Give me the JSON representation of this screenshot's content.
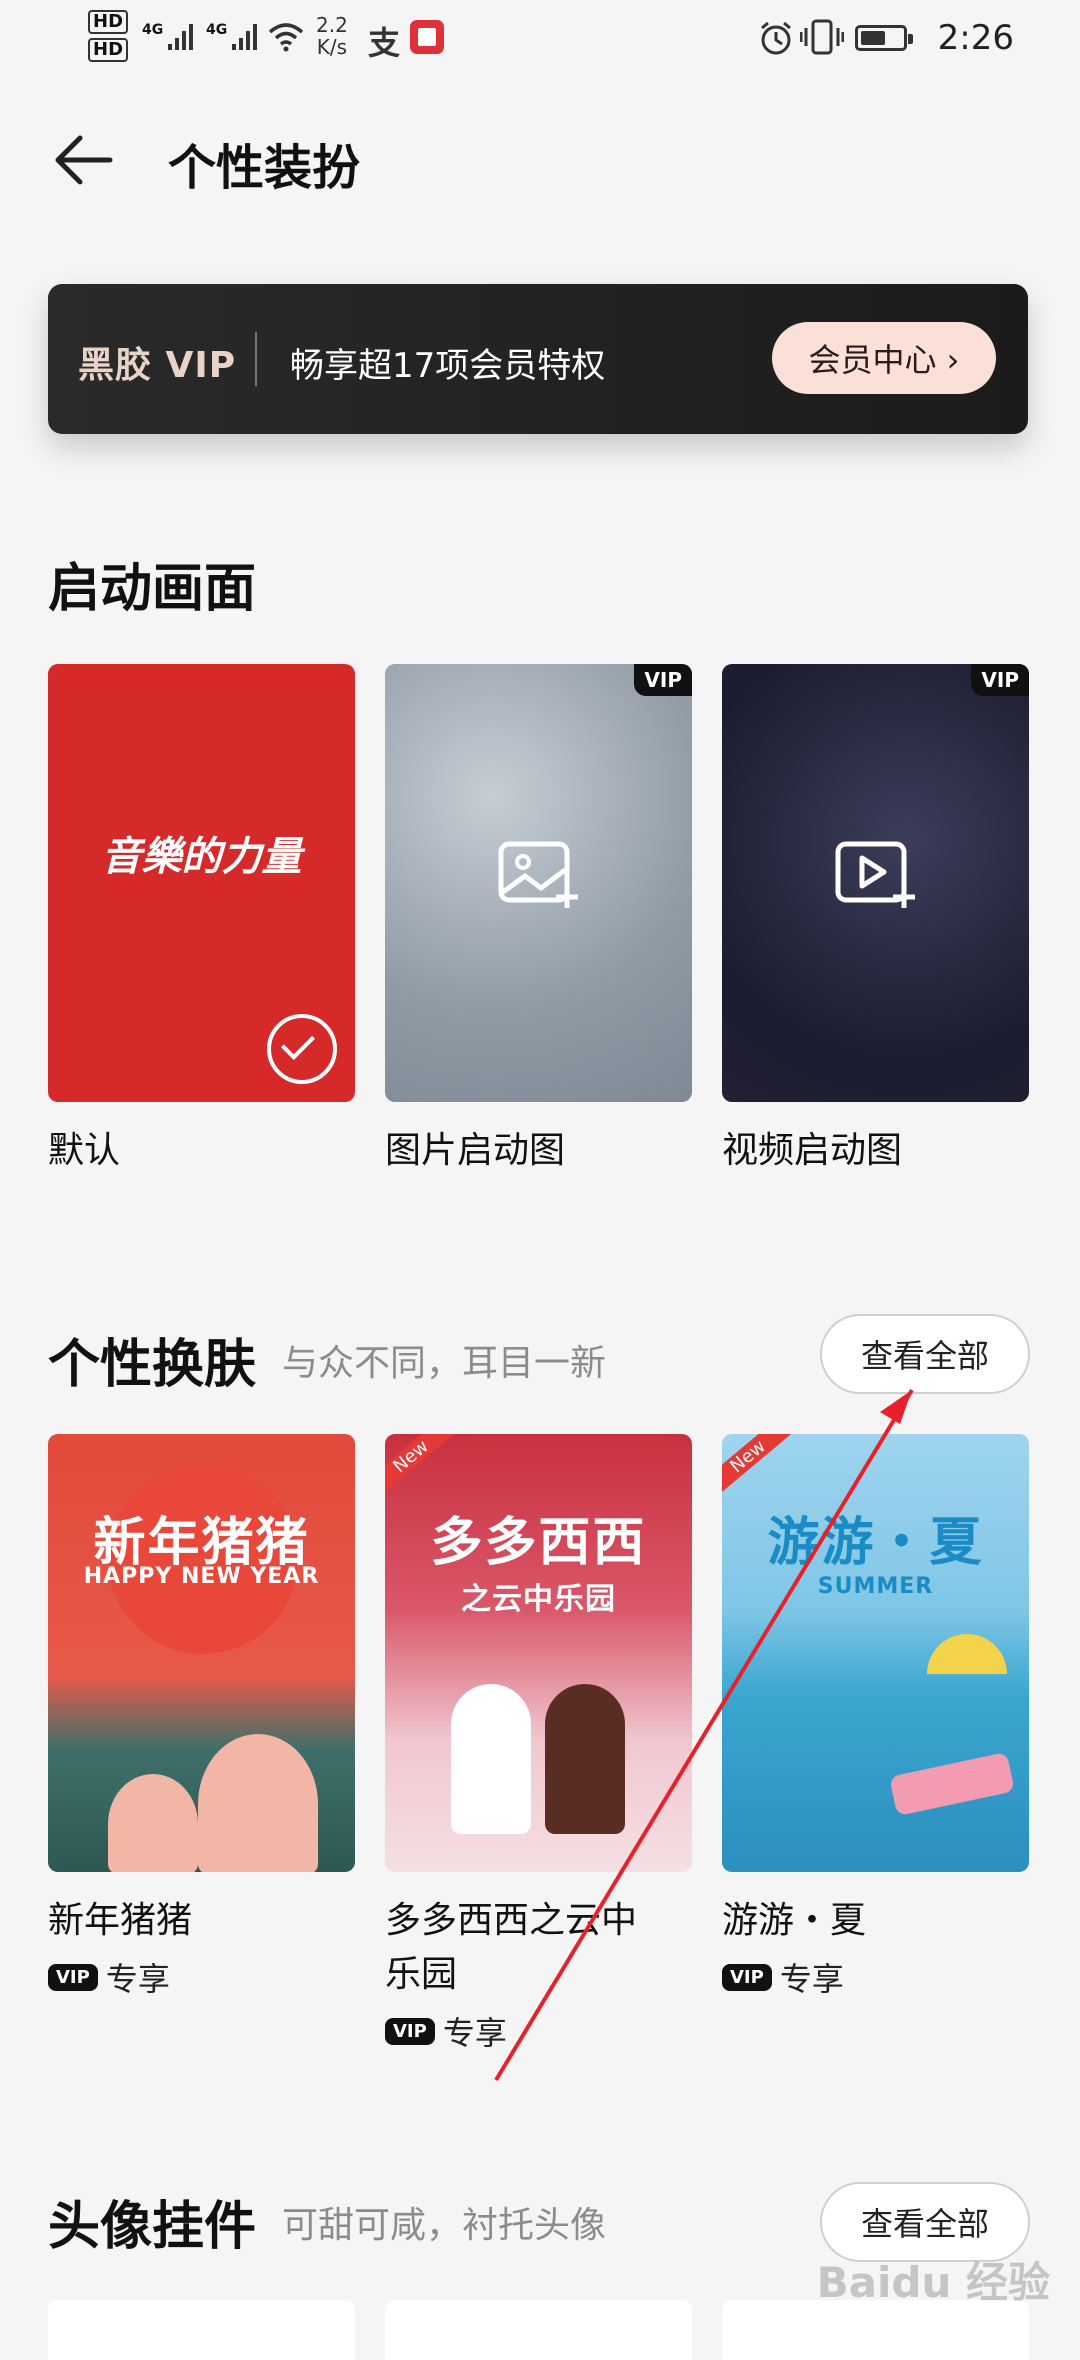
{
  "status_bar": {
    "hd1": "HD",
    "hd2": "HD",
    "net1": "4G",
    "net2": "4G",
    "speed_value": "2.2",
    "speed_unit": "K/s",
    "time": "2:26",
    "battery_level_fraction": 0.6
  },
  "header": {
    "title": "个性装扮"
  },
  "vip_banner": {
    "logo": "黑胶 VIP",
    "text": "畅享超17项会员特权",
    "button": "会员中心 ›"
  },
  "startup": {
    "title": "启动画面",
    "badge": "VIP",
    "items": [
      {
        "label": "默认",
        "art": "音樂的力量"
      },
      {
        "label": "图片启动图"
      },
      {
        "label": "视频启动图"
      }
    ]
  },
  "skins": {
    "title": "个性换肤",
    "subtitle": "与众不同，耳目一新",
    "view_all": "查看全部",
    "new_tag": "New",
    "badge": "VIP",
    "exclusive": "专享",
    "items": [
      {
        "label": "新年猪猪",
        "art_title": "新年猪猪",
        "art_sub": "HAPPY NEW YEAR"
      },
      {
        "label_line1": "多多西西之云中",
        "label_line2": "乐园",
        "art_title": "多多西西",
        "art_sub": "之云中乐园"
      },
      {
        "label": "游游・夏",
        "art_title": "游游・夏",
        "art_sub": "SUMMER"
      }
    ]
  },
  "avatar": {
    "title": "头像挂件",
    "subtitle": "可甜可咸，衬托头像",
    "view_all": "查看全部"
  },
  "watermark": "Baidu 经验"
}
